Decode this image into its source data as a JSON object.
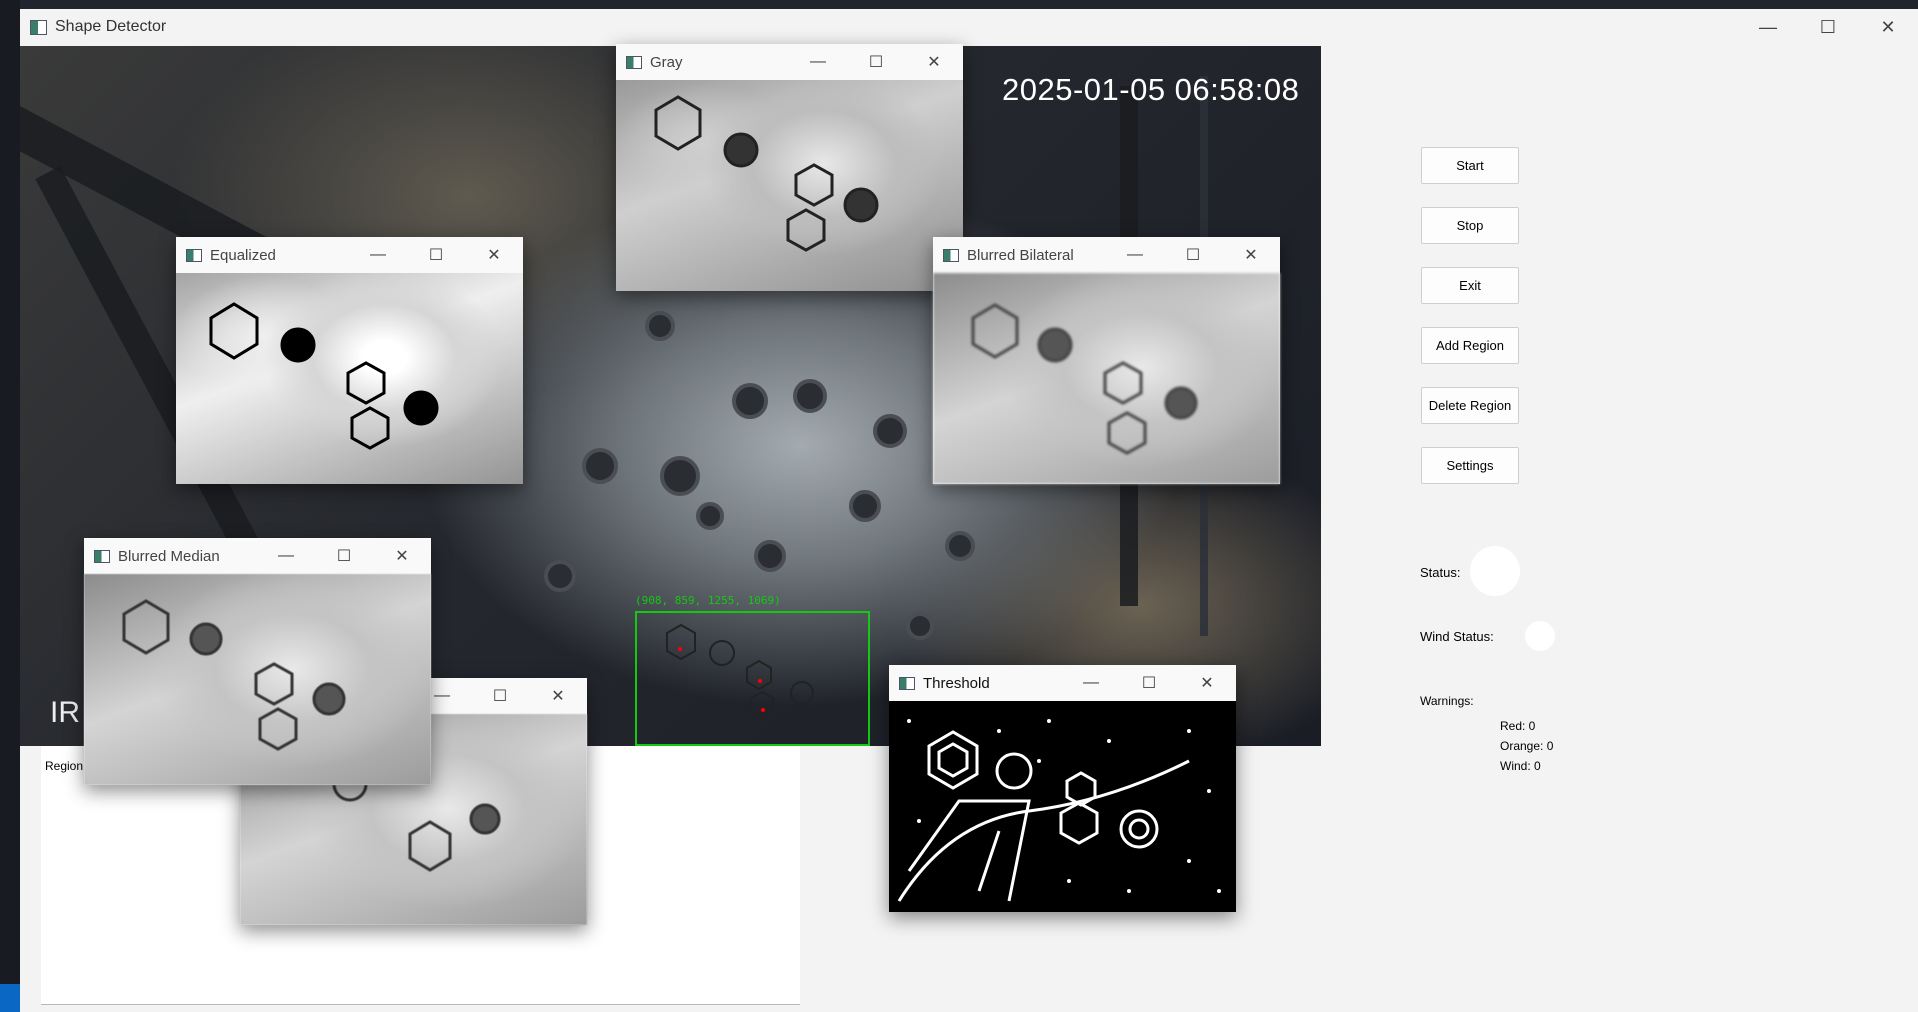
{
  "window": {
    "title": "Shape Detector",
    "controls": {
      "minimize": "—",
      "maximize": "☐",
      "close": "✕"
    }
  },
  "feed": {
    "timestamp": "2025-01-05 06:58:08",
    "overlay_text": "IR",
    "roi_label": "(908, 859, 1255, 1069)"
  },
  "region_panel": {
    "label": "Region"
  },
  "controls": {
    "buttons": [
      "Start",
      "Stop",
      "Exit",
      "Add Region",
      "Delete Region",
      "Settings"
    ],
    "status_label": "Status:",
    "wind_status_label": "Wind Status:",
    "warnings_label": "Warnings:",
    "red": "Red: 0",
    "orange": "Orange: 0",
    "wind": "Wind: 0",
    "status_color": "#ffffff",
    "wind_status_color": "#ffffff"
  },
  "cv_windows": {
    "gray": "Gray",
    "equalized": "Equalized",
    "blurred_bilateral": "Blurred Bilateral",
    "blurred_median": "Blurred Median",
    "threshold": "Threshold"
  },
  "icons": {
    "app": "opencv-window-icon",
    "minimize": "minimize-icon",
    "maximize": "maximize-icon",
    "close": "close-icon"
  }
}
